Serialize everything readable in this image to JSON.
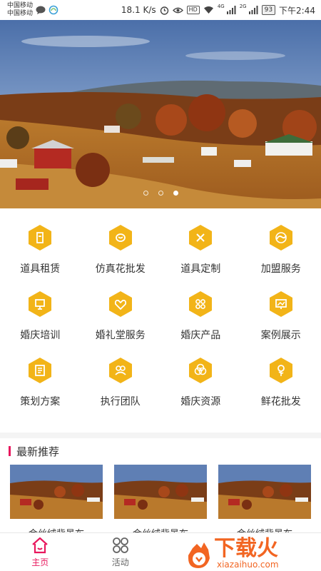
{
  "status_bar": {
    "carrier_1": "中国移动",
    "carrier_2": "中国移动",
    "speed": "18.1 K/s",
    "hd": "HD",
    "net_1": "4G",
    "net_2": "2G",
    "battery": "93",
    "time": "下午2:44"
  },
  "banner": {
    "slide_count": 3,
    "active_index": 2
  },
  "grid": [
    {
      "label": "道具租赁",
      "icon": "props-rental-icon"
    },
    {
      "label": "仿真花批发",
      "icon": "artificial-flower-icon"
    },
    {
      "label": "道具定制",
      "icon": "props-custom-icon"
    },
    {
      "label": "加盟服务",
      "icon": "franchise-icon"
    },
    {
      "label": "婚庆培训",
      "icon": "training-icon"
    },
    {
      "label": "婚礼堂服务",
      "icon": "wedding-hall-icon"
    },
    {
      "label": "婚庆产品",
      "icon": "products-icon"
    },
    {
      "label": "案例展示",
      "icon": "case-showcase-icon"
    },
    {
      "label": "策划方案",
      "icon": "planning-icon"
    },
    {
      "label": "执行团队",
      "icon": "team-icon"
    },
    {
      "label": "婚庆资源",
      "icon": "resources-icon"
    },
    {
      "label": "鲜花批发",
      "icon": "fresh-flower-icon"
    }
  ],
  "section": {
    "title": "最新推荐"
  },
  "cards": [
    {
      "title": "金丝绒背景布"
    },
    {
      "title": "金丝绒背景布"
    },
    {
      "title": "金丝绒背景布"
    }
  ],
  "bottom_nav": [
    {
      "label": "主页",
      "icon": "home-icon",
      "active": true
    },
    {
      "label": "活动",
      "icon": "activity-grid-icon",
      "active": false
    }
  ],
  "watermark": {
    "brand": "下载火",
    "domain": "xiazaihuo.com"
  },
  "colors": {
    "accent": "#e8175d",
    "icon_hex": "#f2b418",
    "text": "#333333"
  }
}
